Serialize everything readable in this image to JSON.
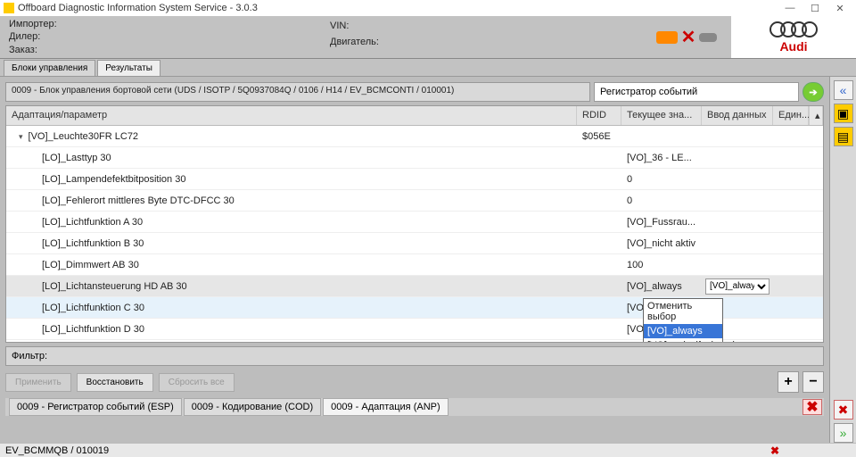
{
  "window": {
    "title": "Offboard Diagnostic Information System Service - 3.0.3"
  },
  "header": {
    "importer": "Импортер:",
    "dealer": "Дилер:",
    "order": "Заказ:",
    "vin": "VIN:",
    "engine": "Двигатель:",
    "brand": "Audi"
  },
  "tabs": {
    "control": "Блоки управления",
    "results": "Результаты"
  },
  "module": {
    "title": "0009 - Блок управления бортовой сети  (UDS / ISOTP / 5Q0937084Q / 0106 / H14 / EV_BCMCONTI / 010001)",
    "function_label": "Регистратор событий"
  },
  "grid": {
    "cols": {
      "name": "Адаптация/параметр",
      "rdid": "RDID",
      "current": "Текущее зна...",
      "input": "Ввод данных",
      "unit": "Един..."
    },
    "group": {
      "name": "[VO]_Leuchte30FR LC72",
      "rdid": "$056E"
    },
    "rows": [
      {
        "name": "[LO]_Lasttyp 30",
        "cur": "[VO]_36 - LE..."
      },
      {
        "name": "[LO]_Lampendefektbitposition 30",
        "cur": "0"
      },
      {
        "name": "[LO]_Fehlerort mittleres Byte DTC-DFCC 30",
        "cur": "0"
      },
      {
        "name": "[LO]_Lichtfunktion A 30",
        "cur": "[VO]_Fussrau..."
      },
      {
        "name": "[LO]_Lichtfunktion B 30",
        "cur": "[VO]_nicht aktiv"
      },
      {
        "name": "[LO]_Dimmwert AB 30",
        "cur": "100"
      },
      {
        "name": "[LO]_Lichtansteuerung HD AB 30",
        "cur": "[VO]_always",
        "input": "[VO]_always",
        "hl": true
      },
      {
        "name": "[LO]_Lichtfunktion C 30",
        "cur": "[VO]_nicht aktiv",
        "sel": true
      },
      {
        "name": "[LO]_Lichtfunktion D 30",
        "cur": "[VO]_nicht aktiv"
      }
    ],
    "dropdown": {
      "cancel": "Отменить выбор",
      "opt1": "[VO]_always",
      "opt2": "[VO]_only_if_closed"
    }
  },
  "filter": {
    "label": "Фильтр:"
  },
  "buttons": {
    "apply": "Применить",
    "restore": "Восстановить",
    "reset_all": "Сбросить все"
  },
  "bottom_tabs": {
    "esp": "0009 - Регистратор событий (ESP)",
    "cod": "0009 - Кодирование (COD)",
    "anp": "0009 - Адаптация (ANP)"
  },
  "status": {
    "text": "EV_BCMMQB / 010019"
  }
}
